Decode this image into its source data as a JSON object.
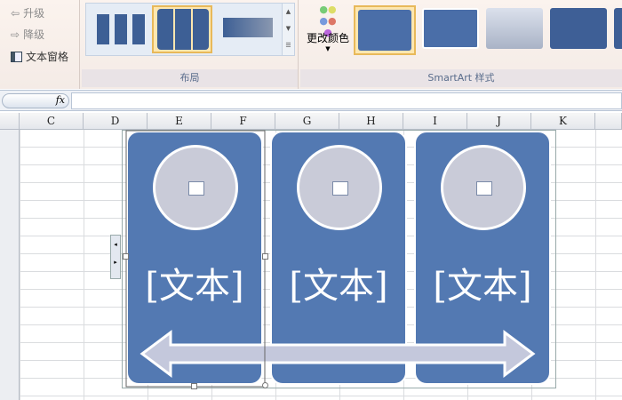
{
  "ribbon": {
    "create_group": {
      "promote": "升级",
      "demote": "降级",
      "text_pane": "文本窗格"
    },
    "layout_group": {
      "label": "布局"
    },
    "styles_group": {
      "change_colors": "更改颜色",
      "label": "SmartArt 样式"
    }
  },
  "formula_bar": {
    "fx": "fx",
    "value": ""
  },
  "columns": [
    "C",
    "D",
    "E",
    "F",
    "G",
    "H",
    "I",
    "J",
    "K"
  ],
  "smartart": {
    "panels": [
      {
        "text": "[文本]"
      },
      {
        "text": "[文本]"
      },
      {
        "text": "[文本]"
      }
    ],
    "fill": "#5379b2"
  }
}
